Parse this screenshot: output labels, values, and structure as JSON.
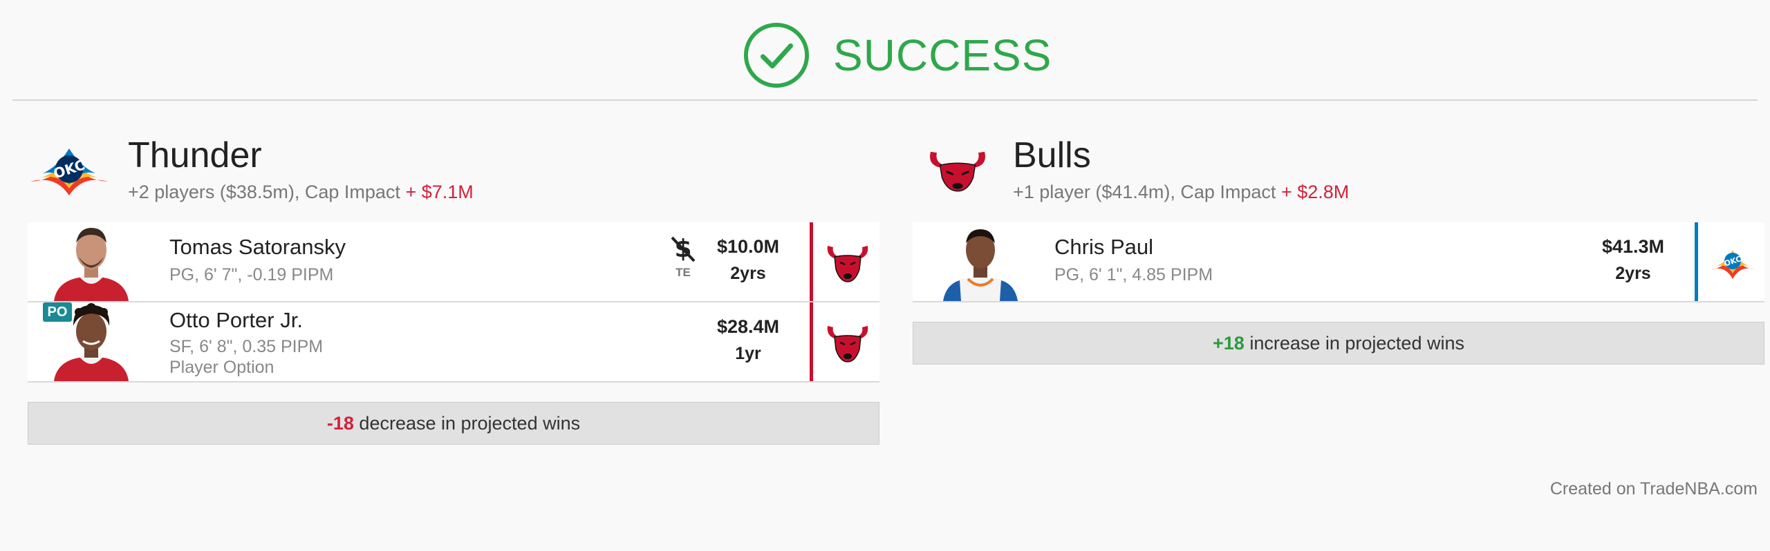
{
  "header": {
    "status": "SUCCESS",
    "status_color": "#2ea84a"
  },
  "teams": [
    {
      "name": "Thunder",
      "logo": "thunder-logo",
      "summary": "+2 players ($38.5m), Cap Impact",
      "cap_impact": "+ $7.1M",
      "players": [
        {
          "name": "Tomas Satoransky",
          "info": "PG, 6' 7\", -0.19 PIPM",
          "salary": "$10.0M",
          "years": "2yrs",
          "te_label": "TE",
          "destination": "bulls-logo"
        },
        {
          "name": "Otto Porter Jr.",
          "info": "SF, 6' 8\", 0.35 PIPM",
          "option": "Player Option",
          "badge": "PO",
          "salary": "$28.4M",
          "years": "1yr",
          "destination": "bulls-logo"
        }
      ],
      "wins": {
        "value": "-18",
        "text": " decrease in projected wins"
      }
    },
    {
      "name": "Bulls",
      "logo": "bulls-logo",
      "summary": "+1 player ($41.4m), Cap Impact",
      "cap_impact": "+ $2.8M",
      "players": [
        {
          "name": "Chris Paul",
          "info": "PG, 6' 1\", 4.85 PIPM",
          "salary": "$41.3M",
          "years": "2yrs",
          "destination": "thunder-logo"
        }
      ],
      "wins": {
        "value": "+18",
        "text": " increase in projected wins"
      }
    }
  ],
  "colors": {
    "bulls_red": "#c8102e",
    "thunder_blue": "#007ac1",
    "negative": "#d3213a",
    "positive": "#2e9a3e"
  },
  "footer": {
    "credit": "Created on TradeNBA.com"
  }
}
